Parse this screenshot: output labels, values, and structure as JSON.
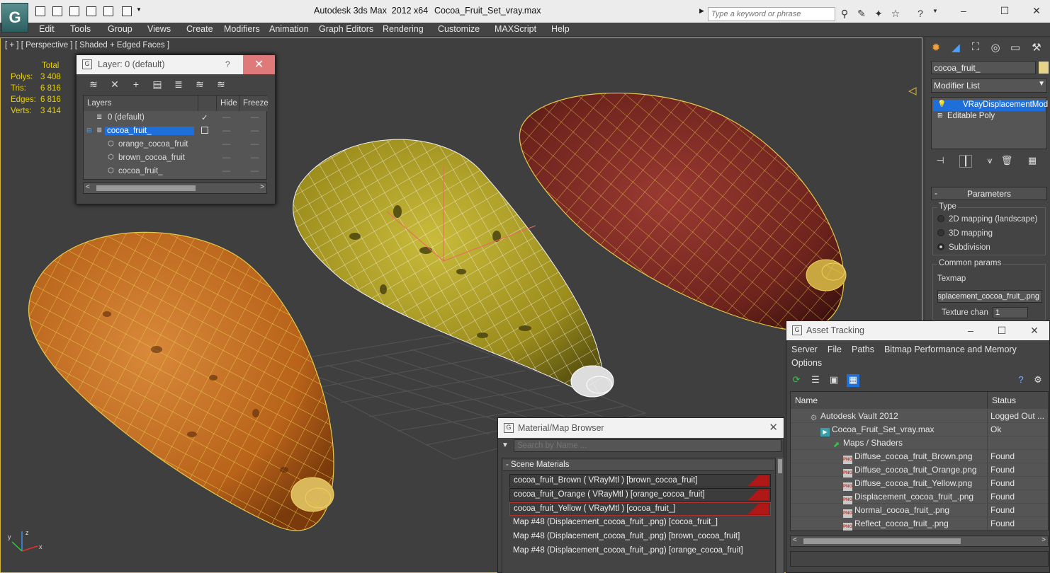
{
  "window": {
    "app_title": "Autodesk 3ds Max  2012 x64",
    "file_title": "Cocoa_Fruit_Set_vray.max",
    "search_placeholder": "Type a keyword or phrase",
    "logo_glyph": "G",
    "minimize_glyph": "–",
    "maximize_glyph": "☐",
    "close_glyph": "✕"
  },
  "menu": {
    "items": [
      "Edit",
      "Tools",
      "Group",
      "Views",
      "Create",
      "Modifiers",
      "Animation",
      "Graph Editors",
      "Rendering",
      "Customize",
      "MAXScript",
      "Help"
    ]
  },
  "viewport": {
    "label": "[ + ] [ Perspective ] [ Shaded + Edged Faces ]",
    "stats_total": "Total",
    "stats": [
      {
        "label": "Polys:",
        "value": "3 408"
      },
      {
        "label": "Tris:",
        "value": "6 816"
      },
      {
        "label": "Edges:",
        "value": "6 816"
      },
      {
        "label": "Verts:",
        "value": "3 414"
      }
    ],
    "axis_x": "x",
    "axis_y": "y",
    "axis_z": "z"
  },
  "layer_dialog": {
    "title": "Layer: 0 (default)",
    "help_glyph": "?",
    "close_glyph": "✕",
    "col_layers": "Layers",
    "col_hide": "Hide",
    "col_freeze": "Freeze",
    "rows": [
      {
        "name": "0 (default)"
      },
      {
        "name": "cocoa_fruit_"
      },
      {
        "name": "orange_cocoa_fruit"
      },
      {
        "name": "brown_cocoa_fruit"
      },
      {
        "name": "cocoa_fruit_"
      }
    ],
    "scroll_left": "<",
    "scroll_right": ">"
  },
  "command_panel": {
    "object_name": "cocoa_fruit_",
    "modifier_list": "Modifier List",
    "stack": [
      {
        "name": "VRayDisplacementMod"
      },
      {
        "name": "Editable Poly"
      }
    ],
    "parameters_title": "Parameters",
    "type_group": "Type",
    "type_options": [
      "2D mapping (landscape)",
      "3D mapping",
      "Subdivision"
    ],
    "common_group": "Common params",
    "texmap_label": "Texmap",
    "texmap_value": "Displacement_cocoa_fruit_.png)",
    "texture_chan_label": "Texture chan",
    "texture_chan_value": "1"
  },
  "asset_tracking": {
    "title": "Asset Tracking",
    "menu": [
      "Server",
      "File",
      "Paths",
      "Bitmap Performance and Memory",
      "Options"
    ],
    "col_name": "Name",
    "col_status": "Status",
    "rows": [
      {
        "name": "Autodesk Vault 2012",
        "status": "Logged Out ..."
      },
      {
        "name": "Cocoa_Fruit_Set_vray.max",
        "status": "Ok"
      },
      {
        "name": "Maps / Shaders",
        "status": ""
      },
      {
        "name": "Diffuse_cocoa_fruit_Brown.png",
        "status": "Found"
      },
      {
        "name": "Diffuse_cocoa_fruit_Orange.png",
        "status": "Found"
      },
      {
        "name": "Diffuse_cocoa_fruit_Yellow.png",
        "status": "Found"
      },
      {
        "name": "Displacement_cocoa_fruit_.png",
        "status": "Found"
      },
      {
        "name": "Normal_cocoa_fruit_.png",
        "status": "Found"
      },
      {
        "name": "Reflect_cocoa_fruit_.png",
        "status": "Found"
      }
    ],
    "png_badge": "PNG",
    "scroll_left": "<",
    "scroll_right": ">"
  },
  "material_browser": {
    "title": "Material/Map Browser",
    "close_glyph": "✕",
    "search_placeholder": "Search by Name ...",
    "section": "Scene Materials",
    "items": [
      "cocoa_fruit_Brown  ( VRayMtl )  [brown_cocoa_fruit]",
      "cocoa_fruit_Orange  ( VRayMtl )  [orange_cocoa_fruit]",
      "cocoa_fruit_Yellow  ( VRayMtl )  [cocoa_fruit_]",
      "Map #48 (Displacement_cocoa_fruit_.png)  [cocoa_fruit_]",
      "Map #48 (Displacement_cocoa_fruit_.png)  [brown_cocoa_fruit]",
      "Map #48 (Displacement_cocoa_fruit_.png)  [orange_cocoa_fruit]"
    ]
  },
  "colors": {
    "selection_blue": "#1e6fd9",
    "wire_yellow": "#e6c84a",
    "stat_yellow": "#e6d100",
    "orange_fruit": "#c8701e",
    "yellow_fruit": "#a99a1e",
    "brown_fruit": "#7a2a22"
  }
}
